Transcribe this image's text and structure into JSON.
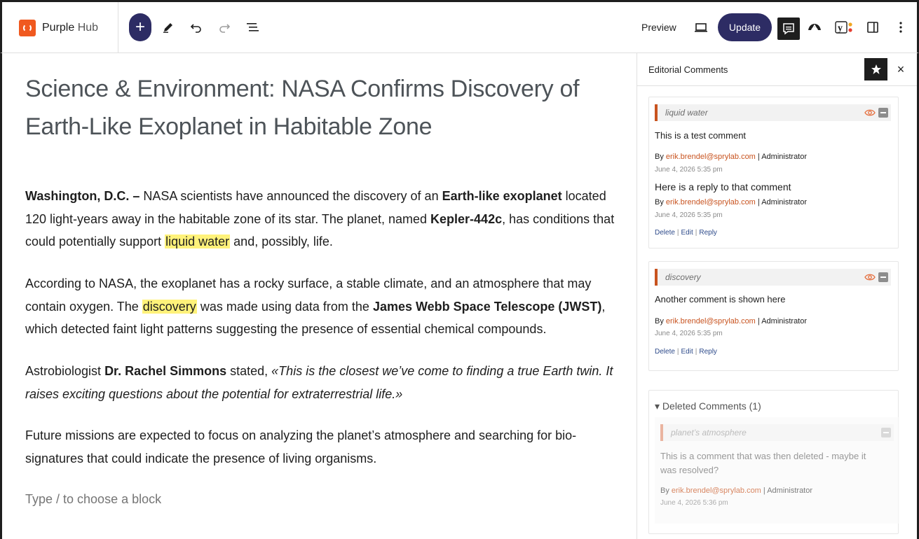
{
  "brand": {
    "name_bold": "Purple",
    "name_thin": " Hub"
  },
  "toolbar": {
    "add_label": "+",
    "preview_label": "Preview",
    "update_label": "Update"
  },
  "post": {
    "title": "Science & Environment: NASA Confirms Discovery of Earth-Like Exoplanet in Habitable Zone",
    "p1": {
      "b1": "Washington, D.C. –",
      "t1": " NASA scientists have announced the discovery of an ",
      "b2": "Earth-like exoplanet",
      "t2": " located 120 light-years away in the habitable zone of its star. The planet, named ",
      "b3": "Kepler-442c",
      "t3": ", has conditions that could potentially support ",
      "hl": "liquid water",
      "t4": " and, possibly, life."
    },
    "p2": {
      "t1": "According to NASA, the exoplanet has a rocky surface, a stable climate, and an atmosphere that may contain oxygen. The ",
      "hl": "discovery",
      "t2": " was made using data from the ",
      "b1": "James Webb Space Telescope (JWST)",
      "t3": ", which detected faint light patterns suggesting the presence of essential chemical compounds."
    },
    "p3": {
      "t1": "Astrobiologist ",
      "b1": "Dr. Rachel Simmons",
      "t2": " stated, ",
      "i1": "«This is the closest we’ve come to finding a true Earth twin. It raises exciting questions about the potential for extraterrestrial life.»"
    },
    "p4": "Future missions are expected to focus on analyzing the planet’s atmosphere and searching for bio-signatures that could indicate the presence of living organisms.",
    "placeholder": "Type / to choose a block"
  },
  "sidebar": {
    "title": "Editorial Comments",
    "close": "×",
    "threads": [
      {
        "quote": "liquid water",
        "comment": "This is a test comment",
        "by": "By ",
        "email": "erik.brendel@sprylab.com",
        "role": " | Administrator",
        "date": "June 4, 2026 5:35 pm",
        "reply": "Here is a reply to that comment",
        "reply_by": "By ",
        "reply_email": "erik.brendel@sprylab.com",
        "reply_role": " | Administrator",
        "reply_date": "June 4, 2026 5:35 pm",
        "actions": [
          "Delete",
          "Edit",
          "Reply"
        ]
      },
      {
        "quote": "discovery",
        "comment": "Another comment is shown here",
        "by": "By ",
        "email": "erik.brendel@sprylab.com",
        "role": " | Administrator",
        "date": "June 4, 2026 5:35 pm",
        "actions": [
          "Delete",
          "Edit",
          "Reply"
        ]
      }
    ],
    "deleted": {
      "header": "▾ Deleted Comments (1)",
      "quote": "planet’s atmosphere",
      "comment": "This is a comment that was then deleted - maybe it was resolved?",
      "by": "By ",
      "email": "erik.brendel@sprylab.com",
      "role": " | Administrator",
      "date": "June 4, 2026 5:36 pm"
    }
  },
  "colors": {
    "accent": "#2d2c64",
    "brand": "#f0591f",
    "highlight": "#fff27a",
    "comment_accent": "#c8531f"
  }
}
